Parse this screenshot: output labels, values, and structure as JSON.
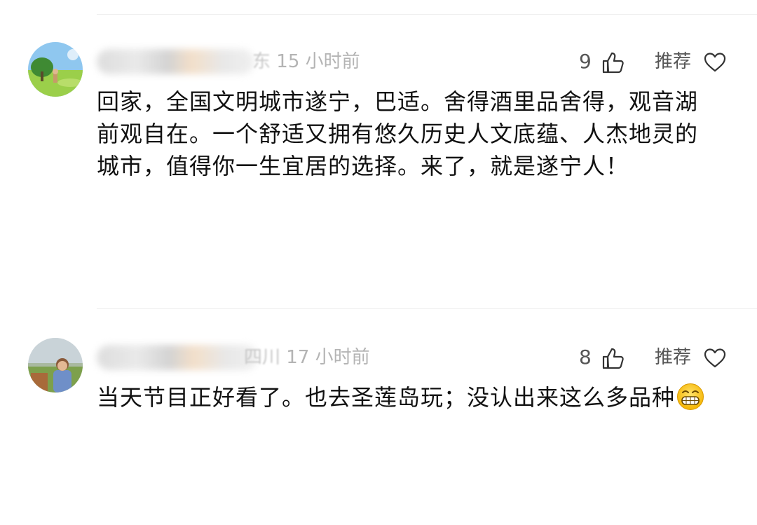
{
  "comments": [
    {
      "username_suffix": "东",
      "time": "15 小时前",
      "likes": "9",
      "recommend_label": "推荐",
      "text": "回家，全国文明城市遂宁，巴适。舍得酒里品舍得，观音湖前观自在。一个舒适又拥有悠久历史人文底蕴、人杰地灵的城市，值得你一生宜居的选择。来了，就是遂宁人！"
    },
    {
      "username_suffix": "四川",
      "time": "17 小时前",
      "likes": "8",
      "recommend_label": "推荐",
      "text": "当天节目正好看了。也去圣莲岛玩；没认出来这么多品种",
      "emoji": "grinning-face-emoji"
    }
  ],
  "icons": {
    "like": "thumbs-up-icon",
    "recommend": "heart-icon"
  },
  "colors": {
    "text": "#111111",
    "meta": "#b4b4b4",
    "divider": "#efefef"
  }
}
